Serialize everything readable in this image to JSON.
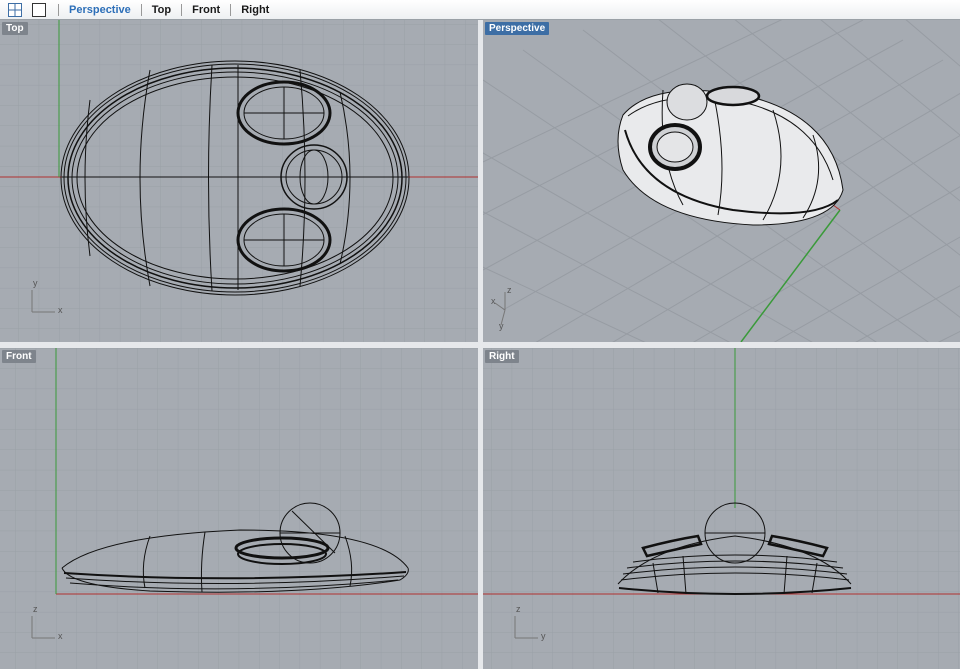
{
  "toolbar": {
    "layout_icon": "four-viewports-icon",
    "single_icon": "single-viewport-icon",
    "tabs": [
      {
        "label": "Perspective",
        "active": true
      },
      {
        "label": "Top",
        "active": false
      },
      {
        "label": "Front",
        "active": false
      },
      {
        "label": "Right",
        "active": false
      }
    ]
  },
  "viewports": {
    "top": {
      "label": "Top",
      "axes": {
        "a": "y",
        "b": "x"
      }
    },
    "perspective": {
      "label": "Perspective",
      "axes": {
        "a": "z",
        "b": "x",
        "c": "y"
      }
    },
    "front": {
      "label": "Front",
      "axes": {
        "a": "z",
        "b": "x"
      }
    },
    "right": {
      "label": "Right",
      "axes": {
        "a": "z",
        "b": "y"
      }
    }
  },
  "colors": {
    "background": "#a6abb2",
    "grid_minor": "#9aa0a7",
    "grid_major": "#8a9098",
    "axis_x": "#b03030",
    "axis_y": "#3a9a3a",
    "active_label": "#3d6ea5",
    "active_tab": "#2d6fb8"
  }
}
